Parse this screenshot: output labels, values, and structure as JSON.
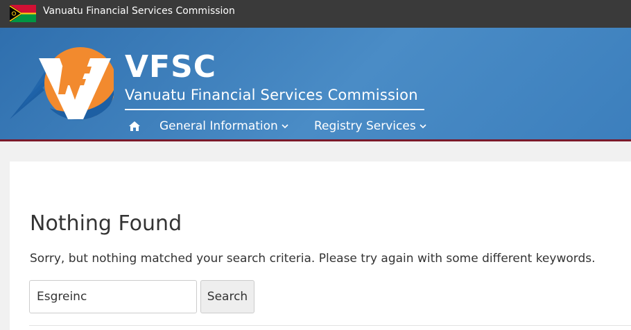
{
  "topbar": {
    "title": "Vanuatu Financial Services Commission",
    "flag_icon": "vanuatu-flag-icon"
  },
  "header": {
    "brand": "VFSC",
    "subtitle": "Vanuatu Financial Services Commission",
    "logo_icon": "vfsc-logo-icon",
    "colors": {
      "header_blue": "#3f80bf",
      "logo_orange": "#f28a2e",
      "accent_line": "#7a1a2b"
    }
  },
  "nav": {
    "home_icon": "home-icon",
    "items": [
      {
        "label": "General Information",
        "icon": "chevron-down-icon"
      },
      {
        "label": "Registry Services",
        "icon": "chevron-down-icon"
      }
    ]
  },
  "main": {
    "title": "Nothing Found",
    "message": "Sorry, but nothing matched your search criteria. Please try again with some different keywords.",
    "search": {
      "value": "Esgreinc",
      "button_label": "Search"
    }
  }
}
